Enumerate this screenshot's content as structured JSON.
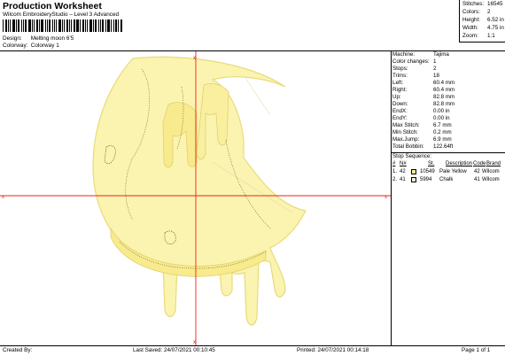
{
  "header": {
    "title": "Production Worksheet",
    "subtitle": "Wilcom EmbroideryStudio – Level 3 Advanced",
    "design_label": "Design:",
    "design_value": "Melting moon 6'5",
    "colorway_label": "Colorway:",
    "colorway_value": "Colorway 1"
  },
  "stats": [
    {
      "label": "Stitches:",
      "value": "16545"
    },
    {
      "label": "Colors:",
      "value": "2"
    },
    {
      "label": "Height:",
      "value": "6.52 in"
    },
    {
      "label": "Width:",
      "value": "4.75 in"
    },
    {
      "label": "Zoom:",
      "value": "1:1"
    }
  ],
  "machine_info": [
    {
      "label": "Machine:",
      "value": "Tajima"
    },
    {
      "label": "Color changes:",
      "value": "1"
    },
    {
      "label": "Stops:",
      "value": "2"
    },
    {
      "label": "Trims:",
      "value": "18"
    },
    {
      "label": "Left:",
      "value": "60.4 mm"
    },
    {
      "label": "Right:",
      "value": "60.4 mm"
    },
    {
      "label": "Up:",
      "value": "82.8 mm"
    },
    {
      "label": "Down:",
      "value": "82.8 mm"
    },
    {
      "label": "EndX:",
      "value": "0.00 in"
    },
    {
      "label": "EndY:",
      "value": "0.00 in"
    },
    {
      "label": "Max Stitch:",
      "value": "6.7 mm"
    },
    {
      "label": "Min Stitch:",
      "value": "0.2 mm"
    },
    {
      "label": "Max.Jump:",
      "value": "6.9 mm"
    },
    {
      "label": "Total Bobbin:",
      "value": "122.64ft"
    }
  ],
  "stop_sequence": {
    "title": "Stop Sequence:",
    "headers": {
      "num": "#",
      "n": "N#",
      "st": "St.",
      "description": "Description",
      "code": "Code",
      "brand": "Brand"
    },
    "rows": [
      {
        "num": "1.",
        "n": "42",
        "st": "10549",
        "description": "Pale Yellow",
        "code": "42",
        "brand": "Wilcom",
        "color": "#f5ee9a"
      },
      {
        "num": "2.",
        "n": "41",
        "st": "5994",
        "description": "Chalk",
        "code": "41",
        "brand": "Wilcom",
        "color": "#f3efd7"
      }
    ]
  },
  "design_canvas": {
    "fill_color": "#fbf3b0",
    "stroke_color": "#e9db7a",
    "crosshair_color": "#e8231a",
    "marker": "x"
  },
  "footer": {
    "created_by": "Created By:",
    "last_saved": "Last Saved: 24/07/2021 00:10:45",
    "printed": "Printed: 24/07/2021 00:14:18",
    "page": "Page 1 of 1"
  }
}
